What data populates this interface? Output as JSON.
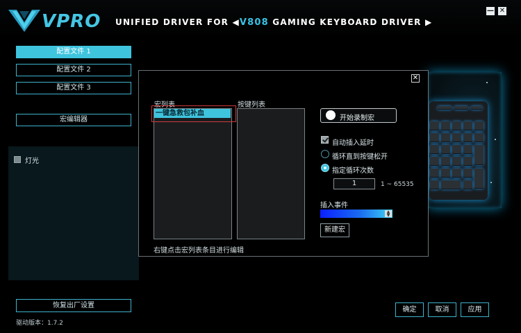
{
  "header": {
    "logo_text": "VPRO",
    "title_prefix": "UNIFIED DRIVER FOR",
    "title_model": "V808",
    "title_suffix": "GAMING KEYBOARD DRIVER",
    "minimize_glyph": "—",
    "close_glyph": "✕"
  },
  "sidebar": {
    "profiles": [
      "配置文件 1",
      "配置文件 2",
      "配置文件 3"
    ],
    "active_profile_index": 0,
    "macro_editor_label": "宏编辑器",
    "light_label": "灯光",
    "reset_label": "恢复出厂设置",
    "version_text": "驱动版本：1.7.2"
  },
  "dialog": {
    "close_glyph": "✕",
    "macro_list_label": "宏列表",
    "key_list_label": "按键列表",
    "macro_items": [
      "一键急救包补血"
    ],
    "hint_text": "右键点击宏列表条目进行编辑",
    "record_label": "开始录制宏",
    "auto_delay_label": "自动插入延时",
    "auto_delay_checked": true,
    "loop_until_release_label": "循环直到按键松开",
    "loop_count_label": "指定循环次数",
    "selected_loop_mode": "count",
    "loop_count_value": "1",
    "loop_count_range": "1 ~ 65535",
    "insert_event_label": "插入事件",
    "new_macro_label": "新建宏"
  },
  "footer": {
    "confirm_label": "确定",
    "cancel_label": "取消",
    "apply_label": "应用"
  },
  "colors": {
    "accent": "#3fc4de",
    "highlight_border": "#d23a3a"
  },
  "icons": {
    "logo": "vpro-logo-icon",
    "record": "record-dot-icon",
    "title_arrows": "triangle-arrow-icon"
  }
}
